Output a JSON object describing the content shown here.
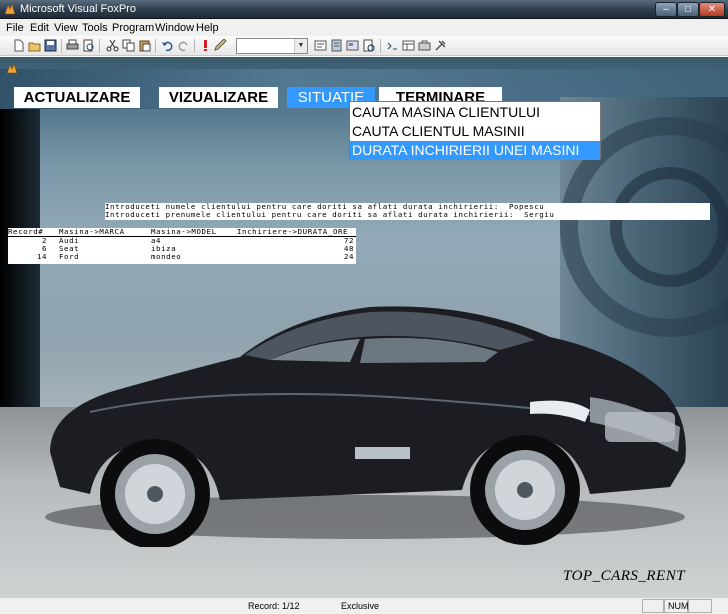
{
  "window": {
    "title": "Microsoft Visual FoxPro"
  },
  "menubar": {
    "items": [
      "File",
      "Edit",
      "View",
      "Tools",
      "Program",
      "Window",
      "Help"
    ]
  },
  "toolbar": {
    "combo_value": ""
  },
  "app_menu": {
    "pads": [
      "ACTUALIZARE",
      "VIZUALIZARE",
      "SITUATIE",
      "TERMINARE"
    ],
    "active_pad": "SITUATIE",
    "popup_items": [
      "CAUTA MASINA CLIENTULUI",
      "CAUTA CLIENTUL MASINII",
      "DURATA INCHIRIERII UNEI MASINI"
    ],
    "selected_popup_item": "DURATA INCHIRIERII UNEI MASINI"
  },
  "prompts": [
    "Introduceti numele clientului pentru care doriti sa aflati durata inchirierii:  Popescu",
    "Introduceti prenumele clientului pentru care doriti sa aflati durata inchirierii:  Sergiu"
  ],
  "results": {
    "headers": [
      "Record#",
      "Masina->MARCA",
      "Masina->MODEL",
      "Inchiriere->DURATA_ORE"
    ],
    "rows": [
      [
        "2",
        "Audi",
        "a4",
        "72"
      ],
      [
        "6",
        "Seat",
        "ibiza",
        "48"
      ],
      [
        "14",
        "Ford",
        "mondeo",
        "24"
      ]
    ]
  },
  "branding": {
    "text": "TOP_CARS_RENT"
  },
  "statusbar": {
    "record": "Record: 1/12",
    "mode": "Exclusive",
    "num": "NUM"
  },
  "colors": {
    "highlight": "#3399ff",
    "titlebar": "#2e3d4c"
  }
}
